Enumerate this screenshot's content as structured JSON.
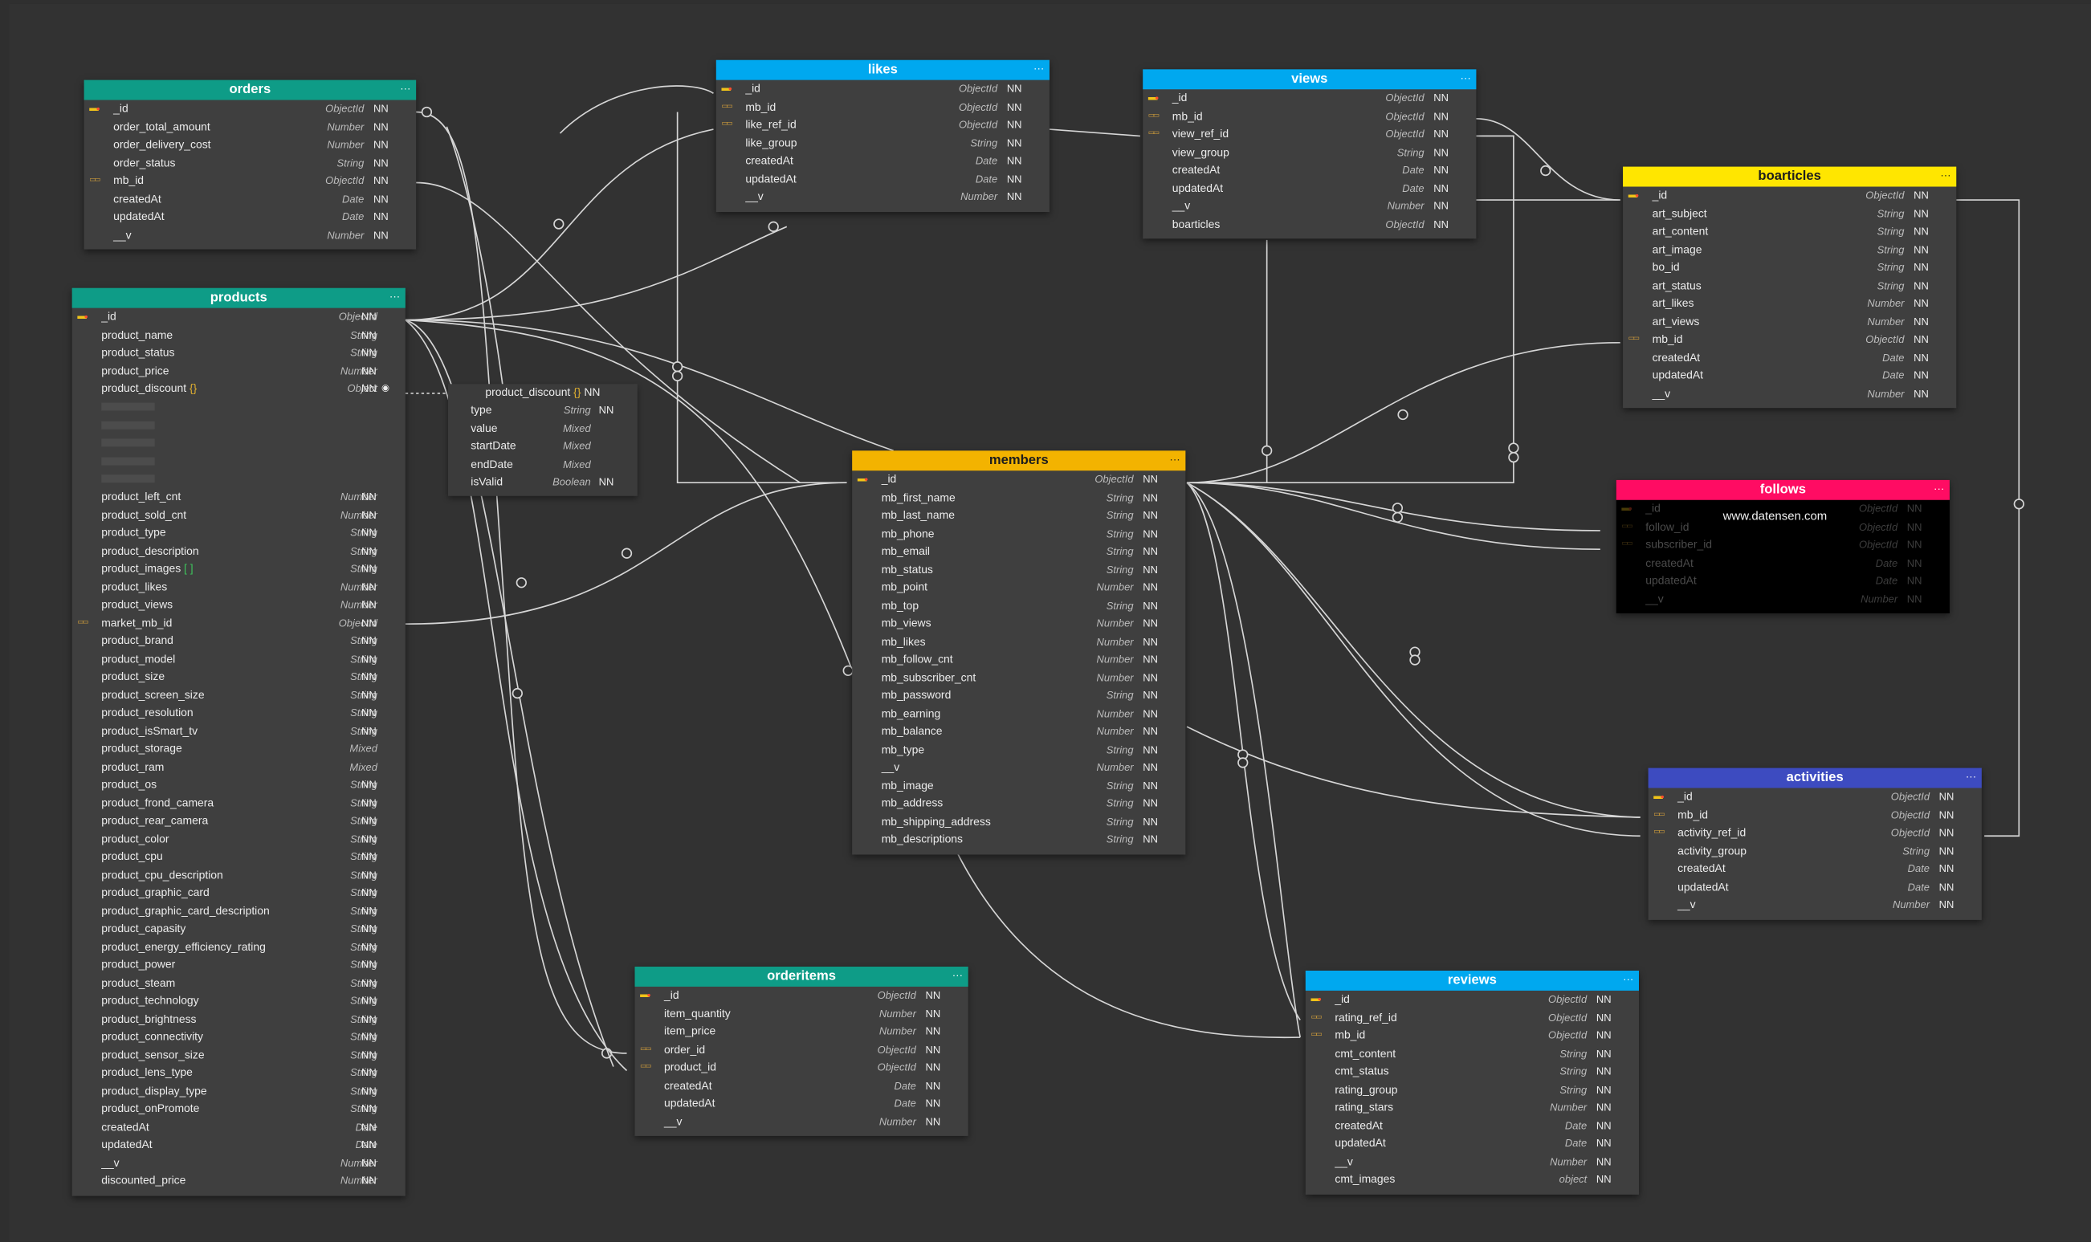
{
  "colors": {
    "canvas": "#323232",
    "table_body": "#3f3f3f",
    "teal": "#0e9c87",
    "sky": "#00a8ef",
    "gold": "#f3b300",
    "yellow": "#ffe600",
    "pink": "#ff0c63",
    "indigo": "#3d4bc0",
    "black": "#000000"
  },
  "tables": [
    {
      "key": "orders",
      "title": "orders",
      "header_color": "#0e9c87",
      "rows": [
        {
          "n": "_id",
          "t": "ObjectId",
          "nn": "NN",
          "k": "pk"
        },
        {
          "n": "order_total_amount",
          "t": "Number",
          "nn": "NN"
        },
        {
          "n": "order_delivery_cost",
          "t": "Number",
          "nn": "NN"
        },
        {
          "n": "order_status",
          "t": "String",
          "nn": "NN"
        },
        {
          "n": "mb_id",
          "t": "ObjectId",
          "nn": "NN",
          "k": "fk"
        },
        {
          "n": "createdAt",
          "t": "Date",
          "nn": "NN"
        },
        {
          "n": "updatedAt",
          "t": "Date",
          "nn": "NN"
        },
        {
          "n": "__v",
          "t": "Number",
          "nn": "NN"
        }
      ]
    },
    {
      "key": "products",
      "title": "products",
      "header_color": "#0e9c87",
      "rows": [
        {
          "n": "_id",
          "t": "ObjectId",
          "nn": "NN",
          "k": "pk"
        },
        {
          "n": "product_name",
          "t": "String",
          "nn": "NN"
        },
        {
          "n": "product_status",
          "t": "String",
          "nn": "NN"
        },
        {
          "n": "product_price",
          "t": "Number",
          "nn": "NN"
        },
        {
          "n": "product_discount",
          "t": "Object",
          "nn": "NN",
          "suffix": "{}"
        },
        {
          "n": "",
          "t": "",
          "nn": "",
          "ph": true
        },
        {
          "n": "",
          "t": "",
          "nn": "",
          "ph": true
        },
        {
          "n": "",
          "t": "",
          "nn": "",
          "ph": true
        },
        {
          "n": "",
          "t": "",
          "nn": "",
          "ph": true
        },
        {
          "n": "",
          "t": "",
          "nn": "",
          "ph": true
        },
        {
          "n": "product_left_cnt",
          "t": "Number",
          "nn": "NN"
        },
        {
          "n": "product_sold_cnt",
          "t": "Number",
          "nn": "NN"
        },
        {
          "n": "product_type",
          "t": "String",
          "nn": "NN"
        },
        {
          "n": "product_description",
          "t": "String",
          "nn": "NN"
        },
        {
          "n": "product_images",
          "t": "String",
          "nn": "NN",
          "suffix": "[ ]"
        },
        {
          "n": "product_likes",
          "t": "Number",
          "nn": "NN"
        },
        {
          "n": "product_views",
          "t": "Number",
          "nn": "NN"
        },
        {
          "n": "market_mb_id",
          "t": "ObjectId",
          "nn": "NN",
          "k": "fk"
        },
        {
          "n": "product_brand",
          "t": "String",
          "nn": "NN"
        },
        {
          "n": "product_model",
          "t": "String",
          "nn": "NN"
        },
        {
          "n": "product_size",
          "t": "String",
          "nn": "NN"
        },
        {
          "n": "product_screen_size",
          "t": "String",
          "nn": "NN"
        },
        {
          "n": "product_resolution",
          "t": "String",
          "nn": "NN"
        },
        {
          "n": "product_isSmart_tv",
          "t": "String",
          "nn": "NN"
        },
        {
          "n": "product_storage",
          "t": "Mixed",
          "nn": ""
        },
        {
          "n": "product_ram",
          "t": "Mixed",
          "nn": ""
        },
        {
          "n": "product_os",
          "t": "String",
          "nn": "NN"
        },
        {
          "n": "product_frond_camera",
          "t": "String",
          "nn": "NN"
        },
        {
          "n": "product_rear_camera",
          "t": "String",
          "nn": "NN"
        },
        {
          "n": "product_color",
          "t": "String",
          "nn": "NN"
        },
        {
          "n": "product_cpu",
          "t": "String",
          "nn": "NN"
        },
        {
          "n": "product_cpu_description",
          "t": "String",
          "nn": "NN"
        },
        {
          "n": "product_graphic_card",
          "t": "String",
          "nn": "NN"
        },
        {
          "n": "product_graphic_card_description",
          "t": "String",
          "nn": "NN"
        },
        {
          "n": "product_capasity",
          "t": "String",
          "nn": "NN"
        },
        {
          "n": "product_energy_efficiency_rating",
          "t": "String",
          "nn": "NN"
        },
        {
          "n": "product_power",
          "t": "String",
          "nn": "NN"
        },
        {
          "n": "product_steam",
          "t": "String",
          "nn": "NN"
        },
        {
          "n": "product_technology",
          "t": "String",
          "nn": "NN"
        },
        {
          "n": "product_brightness",
          "t": "String",
          "nn": "NN"
        },
        {
          "n": "product_connectivity",
          "t": "String",
          "nn": "NN"
        },
        {
          "n": "product_sensor_size",
          "t": "String",
          "nn": "NN"
        },
        {
          "n": "product_lens_type",
          "t": "String",
          "nn": "NN"
        },
        {
          "n": "product_display_type",
          "t": "String",
          "nn": "NN"
        },
        {
          "n": "product_onPromote",
          "t": "String",
          "nn": "NN"
        },
        {
          "n": "createdAt",
          "t": "Date",
          "nn": "NN"
        },
        {
          "n": "updatedAt",
          "t": "Date",
          "nn": "NN"
        },
        {
          "n": "__v",
          "t": "Number",
          "nn": "NN"
        },
        {
          "n": "discounted_price",
          "t": "Number",
          "nn": "NN"
        }
      ]
    },
    {
      "key": "likes",
      "title": "likes",
      "header_color": "#00a8ef",
      "rows": [
        {
          "n": "_id",
          "t": "ObjectId",
          "nn": "NN",
          "k": "pk"
        },
        {
          "n": "mb_id",
          "t": "ObjectId",
          "nn": "NN",
          "k": "fk"
        },
        {
          "n": "like_ref_id",
          "t": "ObjectId",
          "nn": "NN",
          "k": "fk"
        },
        {
          "n": "like_group",
          "t": "String",
          "nn": "NN"
        },
        {
          "n": "createdAt",
          "t": "Date",
          "nn": "NN"
        },
        {
          "n": "updatedAt",
          "t": "Date",
          "nn": "NN"
        },
        {
          "n": "__v",
          "t": "Number",
          "nn": "NN"
        }
      ]
    },
    {
      "key": "views",
      "title": "views",
      "header_color": "#00a8ef",
      "rows": [
        {
          "n": "_id",
          "t": "ObjectId",
          "nn": "NN",
          "k": "pk"
        },
        {
          "n": "mb_id",
          "t": "ObjectId",
          "nn": "NN",
          "k": "fk"
        },
        {
          "n": "view_ref_id",
          "t": "ObjectId",
          "nn": "NN",
          "k": "fk"
        },
        {
          "n": "view_group",
          "t": "String",
          "nn": "NN"
        },
        {
          "n": "createdAt",
          "t": "Date",
          "nn": "NN"
        },
        {
          "n": "updatedAt",
          "t": "Date",
          "nn": "NN"
        },
        {
          "n": "__v",
          "t": "Number",
          "nn": "NN"
        },
        {
          "n": "boarticles",
          "t": "ObjectId",
          "nn": "NN"
        }
      ]
    },
    {
      "key": "boarticles",
      "title": "boarticles",
      "header_color": "#ffe600",
      "rows": [
        {
          "n": "_id",
          "t": "ObjectId",
          "nn": "NN",
          "k": "pk"
        },
        {
          "n": "art_subject",
          "t": "String",
          "nn": "NN"
        },
        {
          "n": "art_content",
          "t": "String",
          "nn": "NN"
        },
        {
          "n": "art_image",
          "t": "String",
          "nn": "NN"
        },
        {
          "n": "bo_id",
          "t": "String",
          "nn": "NN"
        },
        {
          "n": "art_status",
          "t": "String",
          "nn": "NN"
        },
        {
          "n": "art_likes",
          "t": "Number",
          "nn": "NN"
        },
        {
          "n": "art_views",
          "t": "Number",
          "nn": "NN"
        },
        {
          "n": "mb_id",
          "t": "ObjectId",
          "nn": "NN",
          "k": "fk"
        },
        {
          "n": "createdAt",
          "t": "Date",
          "nn": "NN"
        },
        {
          "n": "updatedAt",
          "t": "Date",
          "nn": "NN"
        },
        {
          "n": "__v",
          "t": "Number",
          "nn": "NN"
        }
      ]
    },
    {
      "key": "members",
      "title": "members",
      "header_color": "#f3b300",
      "rows": [
        {
          "n": "_id",
          "t": "ObjectId",
          "nn": "NN",
          "k": "pk"
        },
        {
          "n": "mb_first_name",
          "t": "String",
          "nn": "NN"
        },
        {
          "n": "mb_last_name",
          "t": "String",
          "nn": "NN"
        },
        {
          "n": "mb_phone",
          "t": "String",
          "nn": "NN"
        },
        {
          "n": "mb_email",
          "t": "String",
          "nn": "NN"
        },
        {
          "n": "mb_status",
          "t": "String",
          "nn": "NN"
        },
        {
          "n": "mb_point",
          "t": "Number",
          "nn": "NN"
        },
        {
          "n": "mb_top",
          "t": "String",
          "nn": "NN"
        },
        {
          "n": "mb_views",
          "t": "Number",
          "nn": "NN"
        },
        {
          "n": "mb_likes",
          "t": "Number",
          "nn": "NN"
        },
        {
          "n": "mb_follow_cnt",
          "t": "Number",
          "nn": "NN"
        },
        {
          "n": "mb_subscriber_cnt",
          "t": "Number",
          "nn": "NN"
        },
        {
          "n": "mb_password",
          "t": "String",
          "nn": "NN"
        },
        {
          "n": "mb_earning",
          "t": "Number",
          "nn": "NN"
        },
        {
          "n": "mb_balance",
          "t": "Number",
          "nn": "NN"
        },
        {
          "n": "mb_type",
          "t": "String",
          "nn": "NN"
        },
        {
          "n": "__v",
          "t": "Number",
          "nn": "NN"
        },
        {
          "n": "mb_image",
          "t": "String",
          "nn": "NN"
        },
        {
          "n": "mb_address",
          "t": "String",
          "nn": "NN"
        },
        {
          "n": "mb_shipping_address",
          "t": "String",
          "nn": "NN"
        },
        {
          "n": "mb_descriptions",
          "t": "String",
          "nn": "NN"
        }
      ]
    },
    {
      "key": "follows",
      "title": "follows",
      "header_color": "#ff0c63",
      "rows": [
        {
          "n": "_id",
          "t": "ObjectId",
          "nn": "NN",
          "k": "pk"
        },
        {
          "n": "follow_id",
          "t": "ObjectId",
          "nn": "NN",
          "k": "fk"
        },
        {
          "n": "subscriber_id",
          "t": "ObjectId",
          "nn": "NN",
          "k": "fk"
        },
        {
          "n": "createdAt",
          "t": "Date",
          "nn": "NN"
        },
        {
          "n": "updatedAt",
          "t": "Date",
          "nn": "NN"
        },
        {
          "n": "__v",
          "t": "Number",
          "nn": "NN"
        }
      ]
    },
    {
      "key": "activities",
      "title": "activities",
      "header_color": "#3d4bc0",
      "rows": [
        {
          "n": "_id",
          "t": "ObjectId",
          "nn": "NN",
          "k": "pk"
        },
        {
          "n": "mb_id",
          "t": "ObjectId",
          "nn": "NN",
          "k": "fk"
        },
        {
          "n": "activity_ref_id",
          "t": "ObjectId",
          "nn": "NN",
          "k": "fk"
        },
        {
          "n": "activity_group",
          "t": "String",
          "nn": "NN"
        },
        {
          "n": "createdAt",
          "t": "Date",
          "nn": "NN"
        },
        {
          "n": "updatedAt",
          "t": "Date",
          "nn": "NN"
        },
        {
          "n": "__v",
          "t": "Number",
          "nn": "NN"
        }
      ]
    },
    {
      "key": "orderitems",
      "title": "orderitems",
      "header_color": "#0e9c87",
      "rows": [
        {
          "n": "_id",
          "t": "ObjectId",
          "nn": "NN",
          "k": "pk"
        },
        {
          "n": "item_quantity",
          "t": "Number",
          "nn": "NN"
        },
        {
          "n": "item_price",
          "t": "Number",
          "nn": "NN"
        },
        {
          "n": "order_id",
          "t": "ObjectId",
          "nn": "NN",
          "k": "fk"
        },
        {
          "n": "product_id",
          "t": "ObjectId",
          "nn": "NN",
          "k": "fk"
        },
        {
          "n": "createdAt",
          "t": "Date",
          "nn": "NN"
        },
        {
          "n": "updatedAt",
          "t": "Date",
          "nn": "NN"
        },
        {
          "n": "__v",
          "t": "Number",
          "nn": "NN"
        }
      ]
    },
    {
      "key": "reviews",
      "title": "reviews",
      "header_color": "#00a8ef",
      "rows": [
        {
          "n": "_id",
          "t": "ObjectId",
          "nn": "NN",
          "k": "pk"
        },
        {
          "n": "rating_ref_id",
          "t": "ObjectId",
          "nn": "NN",
          "k": "fk"
        },
        {
          "n": "mb_id",
          "t": "ObjectId",
          "nn": "NN",
          "k": "fk"
        },
        {
          "n": "cmt_content",
          "t": "String",
          "nn": "NN"
        },
        {
          "n": "cmt_status",
          "t": "String",
          "nn": "NN"
        },
        {
          "n": "rating_group",
          "t": "String",
          "nn": "NN"
        },
        {
          "n": "rating_stars",
          "t": "Number",
          "nn": "NN"
        },
        {
          "n": "createdAt",
          "t": "Date",
          "nn": "NN"
        },
        {
          "n": "updatedAt",
          "t": "Date",
          "nn": "NN"
        },
        {
          "n": "__v",
          "t": "Number",
          "nn": "NN"
        },
        {
          "n": "cmt_images",
          "t": "object",
          "nn": "NN"
        }
      ]
    }
  ],
  "product_discount": {
    "title": "product_discount",
    "title_suffix": "{}",
    "title_nn": "NN",
    "rows": [
      {
        "n": "type",
        "t": "String",
        "nn": "NN"
      },
      {
        "n": "value",
        "t": "Mixed",
        "nn": ""
      },
      {
        "n": "startDate",
        "t": "Mixed",
        "nn": ""
      },
      {
        "n": "endDate",
        "t": "Mixed",
        "nn": ""
      },
      {
        "n": "isValid",
        "t": "Boolean",
        "nn": "NN"
      }
    ]
  },
  "watermark": "www.datensen.com",
  "header_menu_glyph": "···"
}
